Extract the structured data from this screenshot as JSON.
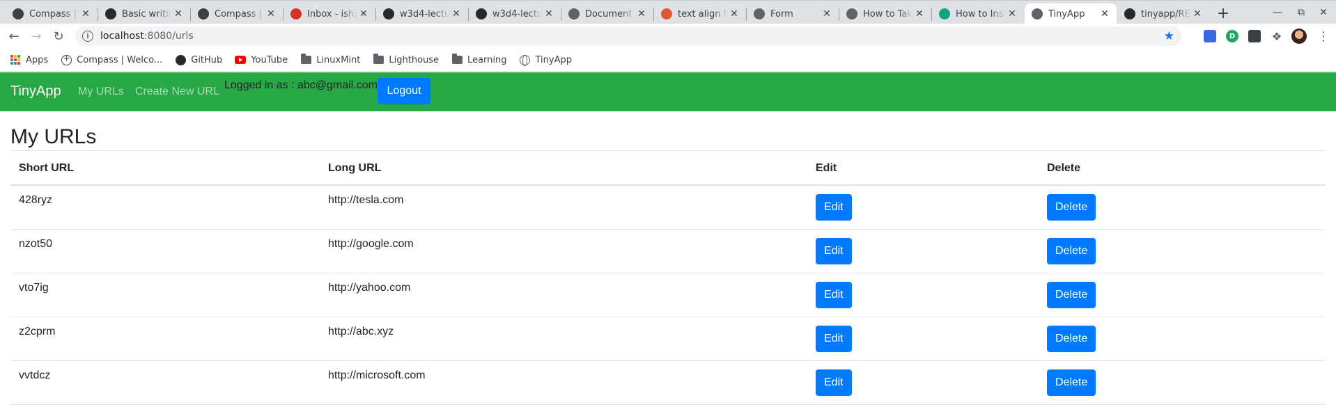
{
  "browser": {
    "tabs": [
      {
        "label": "Compass | S",
        "favicon": "compass-icon",
        "color": "#3c4043"
      },
      {
        "label": "Basic writing",
        "favicon": "github-icon",
        "color": "#24292e"
      },
      {
        "label": "Compass | T",
        "favicon": "compass-icon",
        "color": "#3c4043"
      },
      {
        "label": "Inbox - ishp",
        "favicon": "gmail-icon",
        "color": "#d93025"
      },
      {
        "label": "w3d4-lectur",
        "favicon": "github-icon",
        "color": "#24292e"
      },
      {
        "label": "w3d4-lectur",
        "favicon": "github-icon",
        "color": "#24292e"
      },
      {
        "label": "Document",
        "favicon": "globe-icon",
        "color": "#5f6368"
      },
      {
        "label": "text align to",
        "favicon": "duckduckgo-icon",
        "color": "#de5833"
      },
      {
        "label": "Form",
        "favicon": "globe-icon",
        "color": "#5f6368"
      },
      {
        "label": "How to Take",
        "favicon": "globe-icon",
        "color": "#5f6368"
      },
      {
        "label": "How to Inst",
        "favicon": "openai-icon",
        "color": "#10a37f"
      },
      {
        "label": "TinyApp",
        "favicon": "globe-icon",
        "color": "#5f6368",
        "active": true
      },
      {
        "label": "tinyapp/RE",
        "favicon": "github-icon",
        "color": "#24292e"
      }
    ],
    "address": {
      "host": "localhost",
      "rest": ":8080/urls"
    },
    "bookmarks": [
      {
        "label": "Apps",
        "icon": "apps-grid-icon"
      },
      {
        "label": "Compass | Welco...",
        "icon": "compass-icon"
      },
      {
        "label": "GitHub",
        "icon": "github-icon"
      },
      {
        "label": "YouTube",
        "icon": "youtube-icon"
      },
      {
        "label": "LinuxMint",
        "icon": "folder-icon"
      },
      {
        "label": "Lighthouse",
        "icon": "folder-icon"
      },
      {
        "label": "Learning",
        "icon": "folder-icon"
      },
      {
        "label": "TinyApp",
        "icon": "globe-icon"
      }
    ]
  },
  "nav": {
    "brand": "TinyApp",
    "my_urls": "My URLs",
    "create_new": "Create New URL",
    "logged_in": "Logged in as : abc@gmail.com",
    "logout": "Logout"
  },
  "page": {
    "title": "My URLs",
    "columns": [
      "Short URL",
      "Long URL",
      "Edit",
      "Delete"
    ],
    "rows": [
      {
        "short": "428ryz",
        "long": "http://tesla.com",
        "edit": "Edit",
        "delete": "Delete"
      },
      {
        "short": "nzot50",
        "long": "http://google.com",
        "edit": "Edit",
        "delete": "Delete"
      },
      {
        "short": "vto7ig",
        "long": "http://yahoo.com",
        "edit": "Edit",
        "delete": "Delete"
      },
      {
        "short": "z2cprm",
        "long": "http://abc.xyz",
        "edit": "Edit",
        "delete": "Delete"
      },
      {
        "short": "vvtdcz",
        "long": "http://microsoft.com",
        "edit": "Edit",
        "delete": "Delete"
      }
    ]
  },
  "colors": {
    "navbar": "#28a745",
    "button": "#007bff",
    "text": "#212529"
  }
}
